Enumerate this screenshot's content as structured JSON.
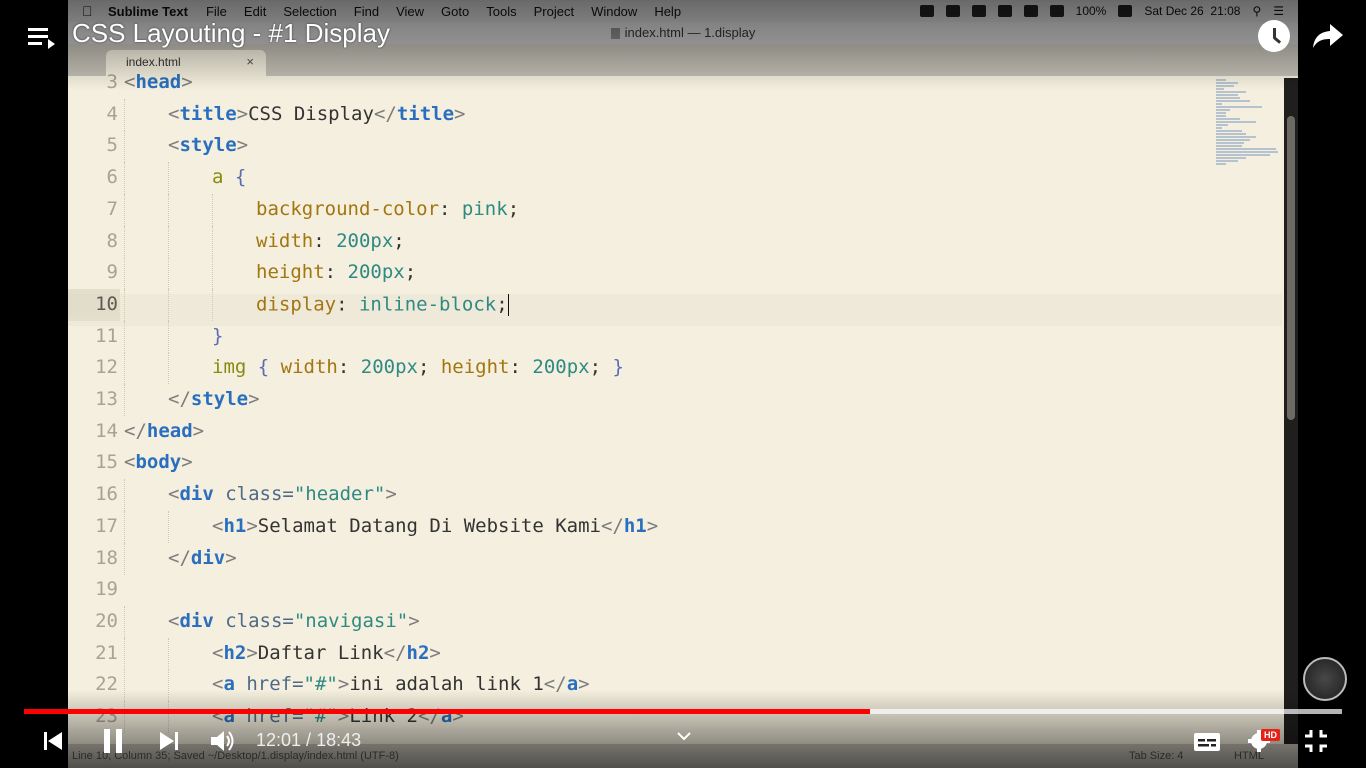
{
  "mac_menubar": {
    "app_name": "Sublime Text",
    "menu_items": [
      "File",
      "Edit",
      "Selection",
      "Find",
      "View",
      "Goto",
      "Tools",
      "Project",
      "Window",
      "Help"
    ],
    "battery": "100%",
    "datetime": "Sat Dec 26  21:08"
  },
  "window": {
    "title": "index.html — 1.display"
  },
  "editor": {
    "tab_label": "index.html",
    "tab_close": "×",
    "active_line": 10,
    "lines": [
      {
        "n": "3",
        "indent": 0,
        "tokens": [
          [
            "t-p",
            "<"
          ],
          [
            "t-tag",
            "head"
          ],
          [
            "t-p",
            ">"
          ]
        ]
      },
      {
        "n": "4",
        "indent": 1,
        "tokens": [
          [
            "t-p",
            "<"
          ],
          [
            "t-tag",
            "title"
          ],
          [
            "t-p",
            ">"
          ],
          [
            "t-txt",
            "CSS Display"
          ],
          [
            "t-p",
            "</"
          ],
          [
            "t-tag",
            "title"
          ],
          [
            "t-p",
            ">"
          ]
        ]
      },
      {
        "n": "5",
        "indent": 1,
        "tokens": [
          [
            "t-p",
            "<"
          ],
          [
            "t-tag",
            "style"
          ],
          [
            "t-p",
            ">"
          ]
        ]
      },
      {
        "n": "6",
        "indent": 2,
        "tokens": [
          [
            "t-sel",
            "a "
          ],
          [
            "t-brace",
            "{"
          ]
        ]
      },
      {
        "n": "7",
        "indent": 3,
        "tokens": [
          [
            "t-prop",
            "background-color"
          ],
          [
            "t-txt",
            ": "
          ],
          [
            "t-val",
            "pink"
          ],
          [
            "t-txt",
            ";"
          ]
        ]
      },
      {
        "n": "8",
        "indent": 3,
        "tokens": [
          [
            "t-prop",
            "width"
          ],
          [
            "t-txt",
            ": "
          ],
          [
            "t-val",
            "200px"
          ],
          [
            "t-txt",
            ";"
          ]
        ]
      },
      {
        "n": "9",
        "indent": 3,
        "tokens": [
          [
            "t-prop",
            "height"
          ],
          [
            "t-txt",
            ": "
          ],
          [
            "t-val",
            "200px"
          ],
          [
            "t-txt",
            ";"
          ]
        ]
      },
      {
        "n": "10",
        "indent": 3,
        "tokens": [
          [
            "t-prop",
            "display"
          ],
          [
            "t-txt",
            ": "
          ],
          [
            "t-val",
            "inline-block"
          ],
          [
            "t-txt",
            ";"
          ]
        ]
      },
      {
        "n": "11",
        "indent": 2,
        "tokens": [
          [
            "t-brace",
            "}"
          ]
        ]
      },
      {
        "n": "12",
        "indent": 2,
        "tokens": [
          [
            "t-sel",
            "img "
          ],
          [
            "t-brace",
            "{ "
          ],
          [
            "t-prop",
            "width"
          ],
          [
            "t-txt",
            ": "
          ],
          [
            "t-val",
            "200px"
          ],
          [
            "t-txt",
            "; "
          ],
          [
            "t-prop",
            "height"
          ],
          [
            "t-txt",
            ": "
          ],
          [
            "t-val",
            "200px"
          ],
          [
            "t-txt",
            "; "
          ],
          [
            "t-brace",
            "}"
          ]
        ]
      },
      {
        "n": "13",
        "indent": 1,
        "tokens": [
          [
            "t-p",
            "</"
          ],
          [
            "t-tag",
            "style"
          ],
          [
            "t-p",
            ">"
          ]
        ]
      },
      {
        "n": "14",
        "indent": 0,
        "tokens": [
          [
            "t-p",
            "</"
          ],
          [
            "t-tag",
            "head"
          ],
          [
            "t-p",
            ">"
          ]
        ]
      },
      {
        "n": "15",
        "indent": 0,
        "tokens": [
          [
            "t-p",
            "<"
          ],
          [
            "t-tag",
            "body"
          ],
          [
            "t-p",
            ">"
          ]
        ]
      },
      {
        "n": "16",
        "indent": 1,
        "tokens": [
          [
            "t-p",
            "<"
          ],
          [
            "t-tag",
            "div"
          ],
          [
            "t-attr",
            " class="
          ],
          [
            "t-str",
            "\"header\""
          ],
          [
            "t-p",
            ">"
          ]
        ]
      },
      {
        "n": "17",
        "indent": 2,
        "tokens": [
          [
            "t-p",
            "<"
          ],
          [
            "t-tag",
            "h1"
          ],
          [
            "t-p",
            ">"
          ],
          [
            "t-txt",
            "Selamat Datang Di Website Kami"
          ],
          [
            "t-p",
            "</"
          ],
          [
            "t-tag",
            "h1"
          ],
          [
            "t-p",
            ">"
          ]
        ]
      },
      {
        "n": "18",
        "indent": 1,
        "tokens": [
          [
            "t-p",
            "</"
          ],
          [
            "t-tag",
            "div"
          ],
          [
            "t-p",
            ">"
          ]
        ]
      },
      {
        "n": "19",
        "indent": 0,
        "tokens": []
      },
      {
        "n": "20",
        "indent": 1,
        "tokens": [
          [
            "t-p",
            "<"
          ],
          [
            "t-tag",
            "div"
          ],
          [
            "t-attr",
            " class="
          ],
          [
            "t-str",
            "\"navigasi\""
          ],
          [
            "t-p",
            ">"
          ]
        ]
      },
      {
        "n": "21",
        "indent": 2,
        "tokens": [
          [
            "t-p",
            "<"
          ],
          [
            "t-tag",
            "h2"
          ],
          [
            "t-p",
            ">"
          ],
          [
            "t-txt",
            "Daftar Link"
          ],
          [
            "t-p",
            "</"
          ],
          [
            "t-tag",
            "h2"
          ],
          [
            "t-p",
            ">"
          ]
        ]
      },
      {
        "n": "22",
        "indent": 2,
        "tokens": [
          [
            "t-p",
            "<"
          ],
          [
            "t-tag",
            "a"
          ],
          [
            "t-attr",
            " href="
          ],
          [
            "t-str",
            "\"#\""
          ],
          [
            "t-p",
            ">"
          ],
          [
            "t-txt",
            "ini adalah link 1"
          ],
          [
            "t-p",
            "</"
          ],
          [
            "t-tag",
            "a"
          ],
          [
            "t-p",
            ">"
          ]
        ]
      },
      {
        "n": "23",
        "indent": 2,
        "tokens": [
          [
            "t-p",
            "<"
          ],
          [
            "t-tag",
            "a"
          ],
          [
            "t-attr",
            " href="
          ],
          [
            "t-str",
            "\"#\""
          ],
          [
            "t-p",
            ">"
          ],
          [
            "t-txt",
            "Link 2"
          ],
          [
            "t-p",
            "</"
          ],
          [
            "t-tag",
            "a"
          ],
          [
            "t-p",
            ">"
          ]
        ]
      }
    ]
  },
  "statusbar": {
    "position": "Line 10, Column 35; Saved ~/Desktop/1.display/index.html (UTF-8)",
    "tab_size": "Tab Size: 4",
    "syntax": "HTML"
  },
  "youtube": {
    "title": "CSS Layouting - #1 Display",
    "current_time": "12:01",
    "separator": " / ",
    "duration": "18:43",
    "progress_fraction": 0.642,
    "loaded_fraction": 1.0,
    "hd_label": "HD",
    "icons": [
      "playlist-icon",
      "watch-later-icon",
      "share-icon",
      "previous-icon",
      "pause-icon",
      "next-icon",
      "volume-icon",
      "chevron-down-icon",
      "subtitles-icon",
      "settings-icon",
      "fullscreen-exit-icon"
    ]
  }
}
